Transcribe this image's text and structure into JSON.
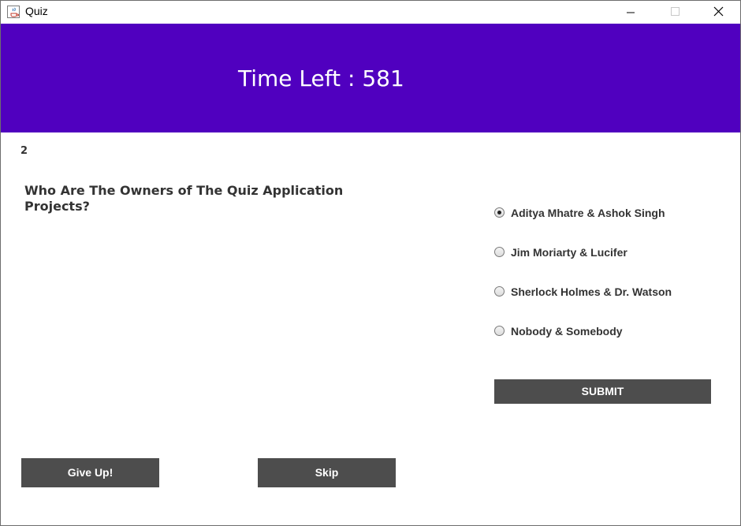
{
  "window": {
    "title": "Quiz",
    "icon": "java-cup-icon",
    "controls": [
      "minimize-icon",
      "maximize-icon",
      "close-icon"
    ]
  },
  "header": {
    "timer_label": "Time Left : ",
    "timer_value": "581",
    "background": "#5000bf"
  },
  "question": {
    "number": "2",
    "text": "Who Are The Owners of The Quiz Application Projects?"
  },
  "options": [
    {
      "label": "Aditya Mhatre & Ashok Singh",
      "selected": true
    },
    {
      "label": "Jim Moriarty & Lucifer",
      "selected": false
    },
    {
      "label": "Sherlock Holmes & Dr. Watson",
      "selected": false
    },
    {
      "label": "Nobody & Somebody",
      "selected": false
    }
  ],
  "buttons": {
    "submit": "SUBMIT",
    "give_up": "Give Up!",
    "skip": "Skip",
    "color": "#4d4d4d"
  }
}
